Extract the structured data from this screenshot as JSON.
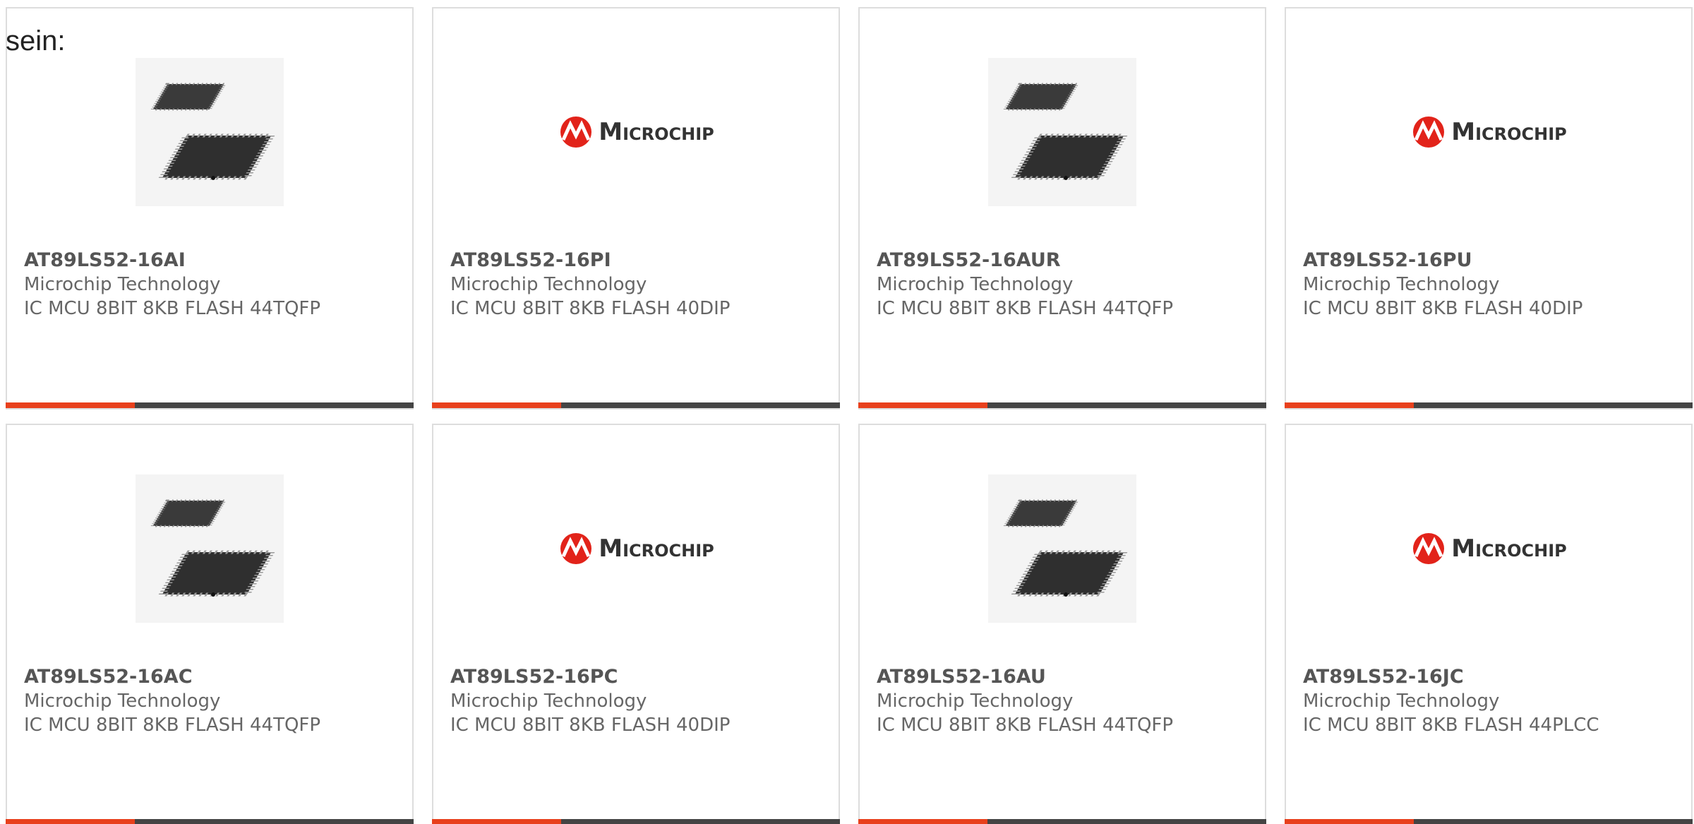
{
  "intro_text": "sein:",
  "colors": {
    "accent": "#e8401c",
    "bar_dark": "#444444",
    "border": "#dddddd",
    "microchip_red": "#e2231a"
  },
  "cards": [
    {
      "part": "AT89LS52-16AI",
      "manufacturer": "Microchip Technology",
      "description": "IC MCU 8BIT 8KB FLASH 44TQFP",
      "image": "chip-image"
    },
    {
      "part": "AT89LS52-16PI",
      "manufacturer": "Microchip Technology",
      "description": "IC MCU 8BIT 8KB FLASH 40DIP",
      "image": "microchip-logo",
      "logo_text": "Microchip"
    },
    {
      "part": "AT89LS52-16AUR",
      "manufacturer": "Microchip Technology",
      "description": "IC MCU 8BIT 8KB FLASH 44TQFP",
      "image": "chip-image"
    },
    {
      "part": "AT89LS52-16PU",
      "manufacturer": "Microchip Technology",
      "description": "IC MCU 8BIT 8KB FLASH 40DIP",
      "image": "microchip-logo",
      "logo_text": "Microchip"
    },
    {
      "part": "AT89LS52-16AC",
      "manufacturer": "Microchip Technology",
      "description": "IC MCU 8BIT 8KB FLASH 44TQFP",
      "image": "chip-image"
    },
    {
      "part": "AT89LS52-16PC",
      "manufacturer": "Microchip Technology",
      "description": "IC MCU 8BIT 8KB FLASH 40DIP",
      "image": "microchip-logo",
      "logo_text": "Microchip"
    },
    {
      "part": "AT89LS52-16AU",
      "manufacturer": "Microchip Technology",
      "description": "IC MCU 8BIT 8KB FLASH 44TQFP",
      "image": "chip-image"
    },
    {
      "part": "AT89LS52-16JC",
      "manufacturer": "Microchip Technology",
      "description": "IC MCU 8BIT 8KB FLASH 44PLCC",
      "image": "microchip-logo",
      "logo_text": "Microchip"
    }
  ]
}
